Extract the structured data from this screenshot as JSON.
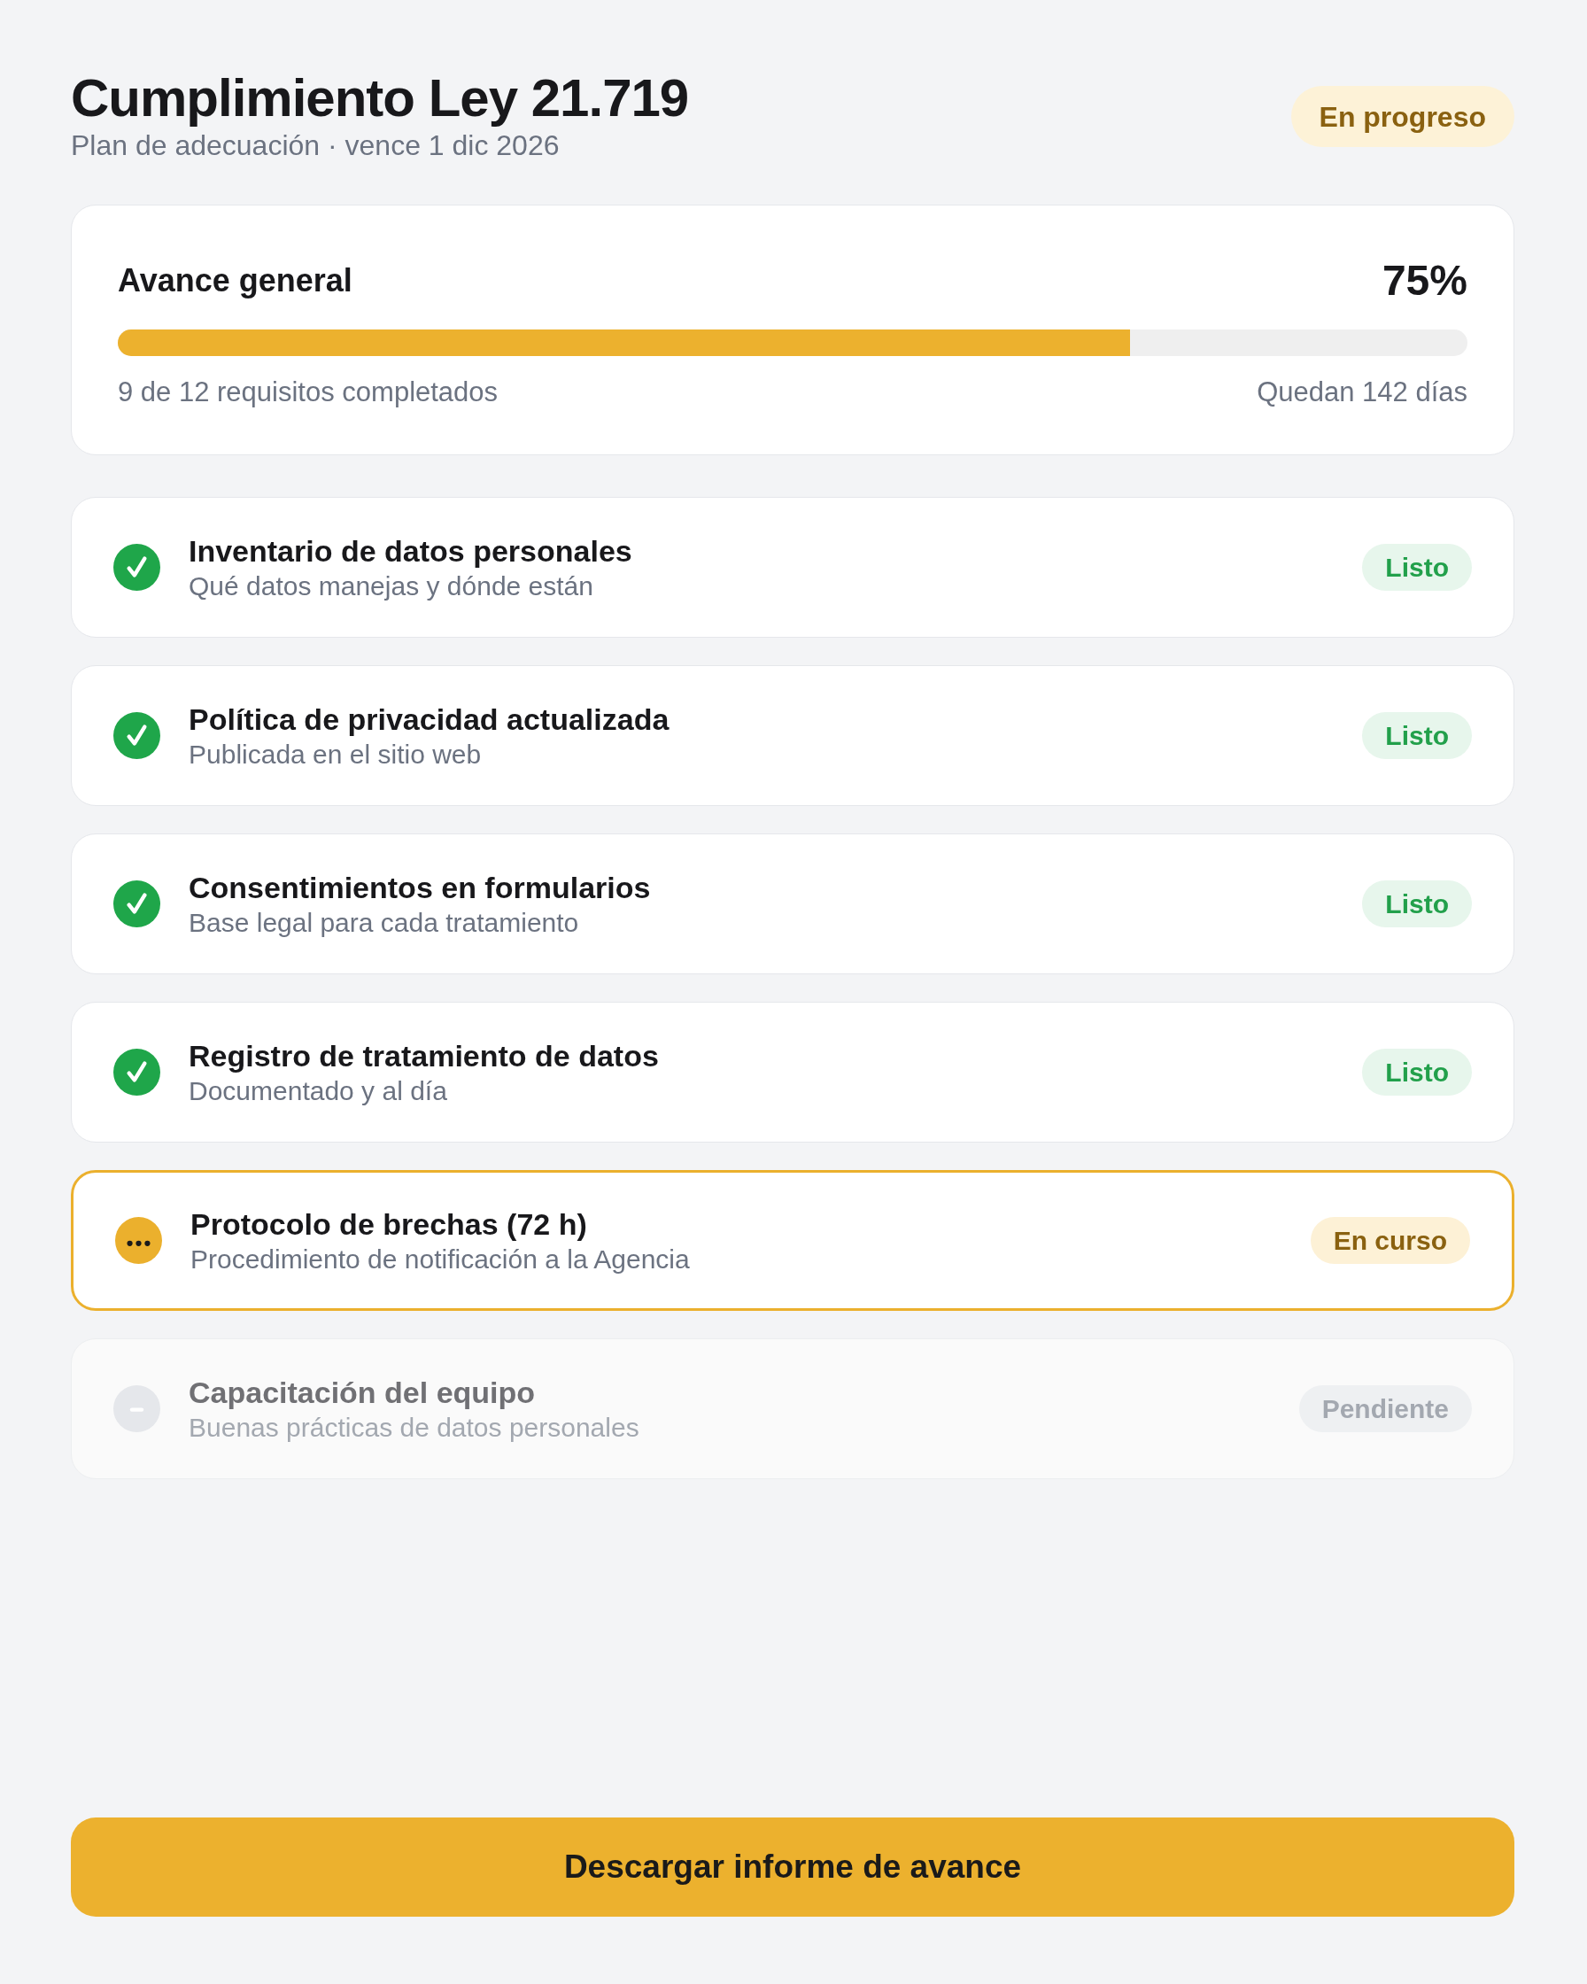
{
  "header": {
    "title": "Cumplimiento Ley 21.719",
    "subtitle": "Plan de adecuación · vence 1 dic 2026",
    "status_badge": "En progreso"
  },
  "progress": {
    "label": "Avance general",
    "percent": "75%",
    "level": 0.75,
    "completed_text": "9 de 12 requisitos completados",
    "remaining_text": "Quedan 142 días"
  },
  "requirements": [
    {
      "kind": "done",
      "title": "Inventario de datos personales",
      "description": "Qué datos manejas y dónde están",
      "badge": "Listo"
    },
    {
      "kind": "done",
      "title": "Política de privacidad actualizada",
      "description": "Publicada en el sitio web",
      "badge": "Listo"
    },
    {
      "kind": "done",
      "title": "Consentimientos en formularios",
      "description": "Base legal para cada tratamiento",
      "badge": "Listo"
    },
    {
      "kind": "done",
      "title": "Registro de tratamiento de datos",
      "description": "Documentado y al día",
      "badge": "Listo"
    },
    {
      "kind": "active",
      "title": "Protocolo de brechas (72 h)",
      "description": "Procedimiento de notificación a la Agencia",
      "badge": "En curso"
    },
    {
      "kind": "pending",
      "title": "Capacitación del equipo",
      "description": "Buenas prácticas de datos personales",
      "badge": "Pendiente"
    }
  ],
  "action_button": {
    "label": "Descargar informe de avance"
  }
}
